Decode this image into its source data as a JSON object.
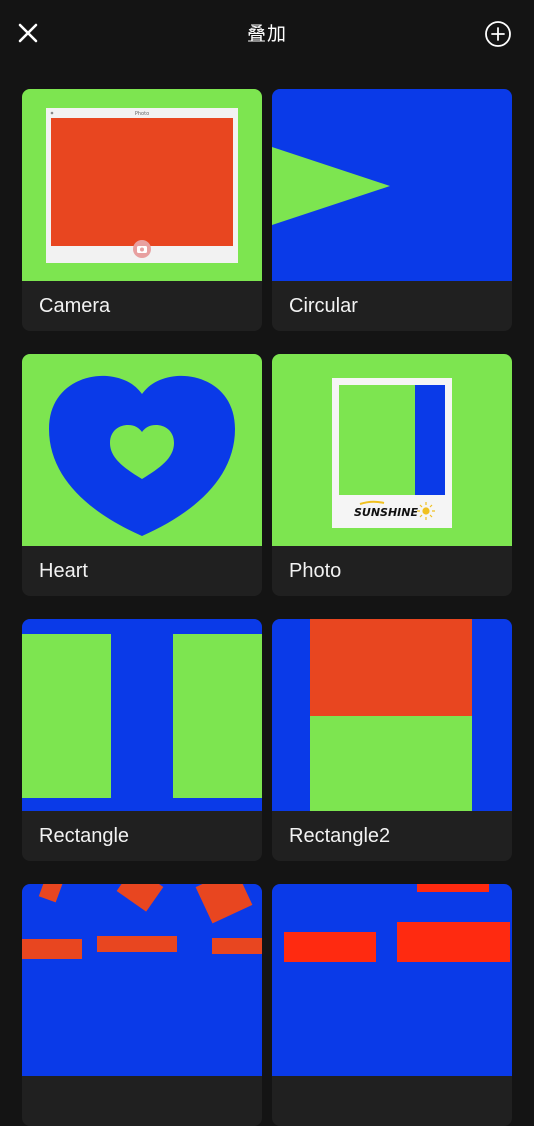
{
  "header": {
    "title": "叠加",
    "close_icon": "close-icon",
    "add_icon": "plus-circle-icon"
  },
  "overlays": [
    {
      "label": "Camera",
      "preview_caption": "Photo"
    },
    {
      "label": "Circular"
    },
    {
      "label": "Heart"
    },
    {
      "label": "Photo",
      "preview_caption": "SUNSHINE"
    },
    {
      "label": "Rectangle"
    },
    {
      "label": "Rectangle2"
    },
    {
      "label": ""
    },
    {
      "label": ""
    }
  ],
  "colors": {
    "background": "#141414",
    "card": "#202020",
    "green": "#7de550",
    "blue": "#0a3ae8",
    "orange": "#e84620"
  }
}
